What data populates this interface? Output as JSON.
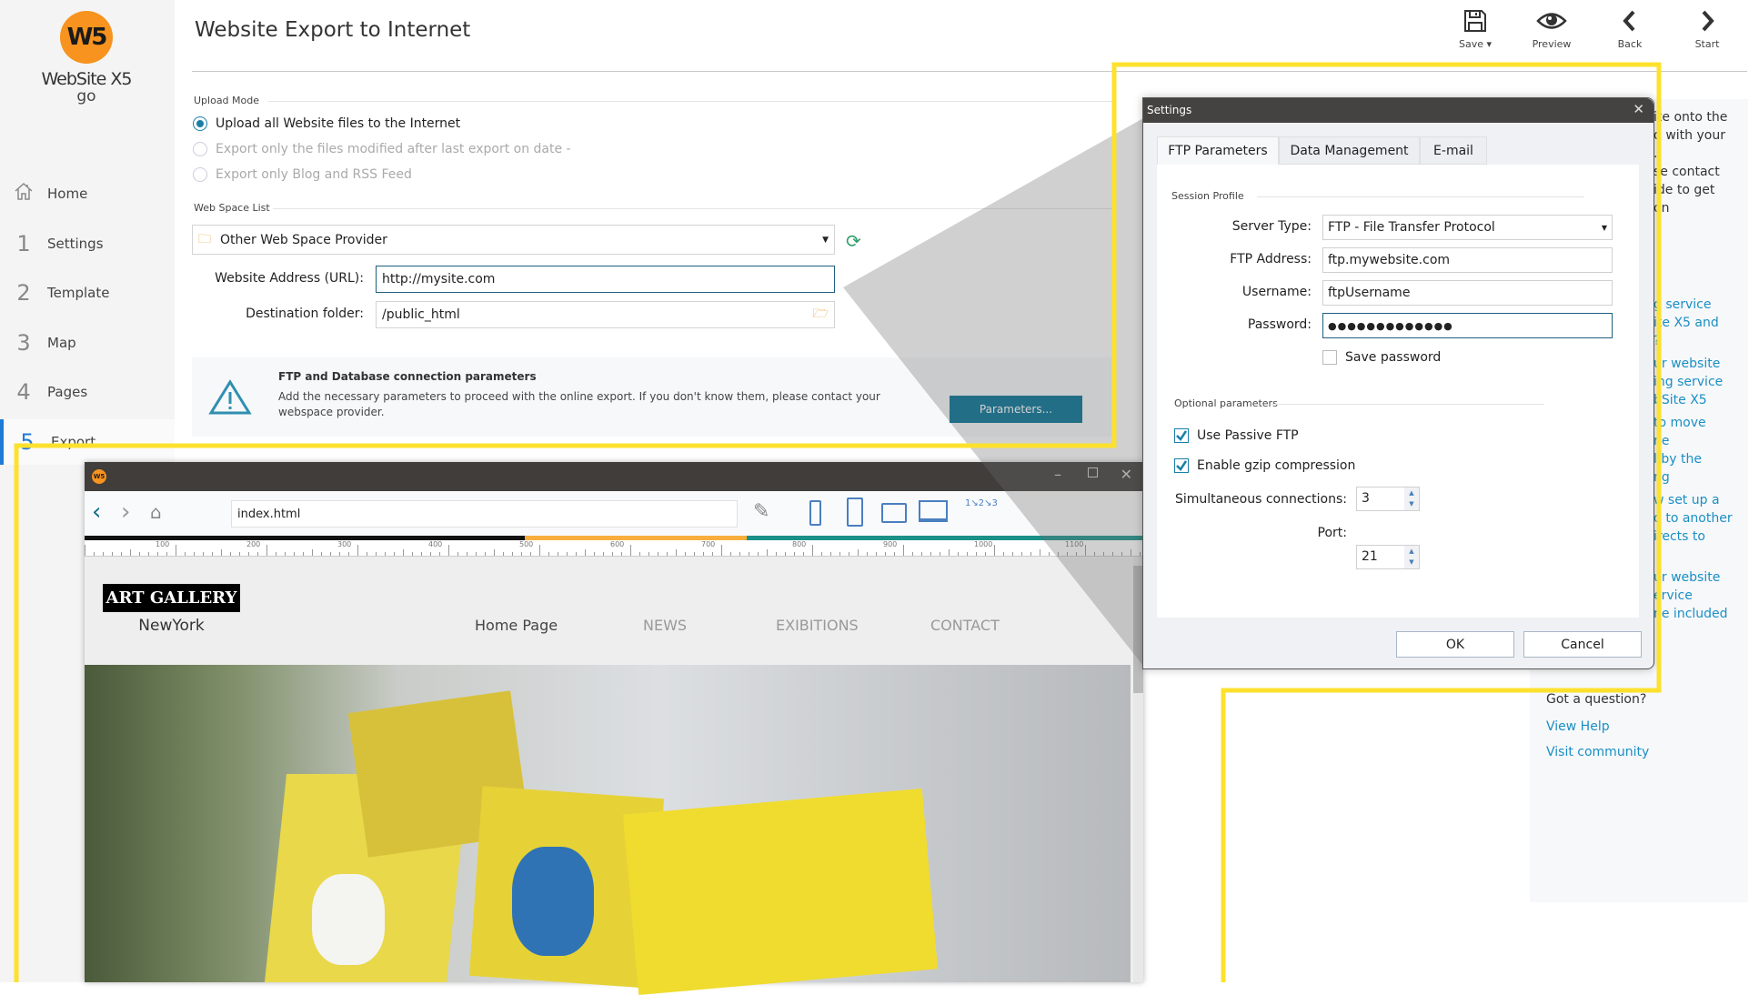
{
  "app": {
    "logo_text": "W5",
    "brand": "WebSite X5",
    "brand_sub": "go"
  },
  "sidebar": {
    "items": [
      {
        "num": "",
        "label": "Home"
      },
      {
        "num": "1",
        "label": "Settings"
      },
      {
        "num": "2",
        "label": "Template"
      },
      {
        "num": "3",
        "label": "Map"
      },
      {
        "num": "4",
        "label": "Pages"
      },
      {
        "num": "5",
        "label": "Export",
        "active": true
      }
    ]
  },
  "header": {
    "title": "Website Export to Internet"
  },
  "toolbar": {
    "save": "Save",
    "preview": "Preview",
    "back": "Back",
    "start": "Start"
  },
  "main": {
    "upload_mode_label": "Upload Mode",
    "upload_options": [
      {
        "label": "Upload all Website files to the Internet",
        "selected": true,
        "enabled": true
      },
      {
        "label": "Export only the files modified after last export on date -",
        "selected": false,
        "enabled": false
      },
      {
        "label": "Export only Blog and RSS Feed",
        "selected": false,
        "enabled": false
      }
    ],
    "web_space_label": "Web Space List",
    "web_space_value": "Other Web Space Provider",
    "url_label": "Website Address (URL):",
    "url_value": "http://mysite.com",
    "dest_label": "Destination folder:",
    "dest_value": "/public_html",
    "info_title": "FTP and Database connection parameters",
    "info_text": "Add the necessary parameters to proceed with the online export. If you don't know them, please contact your webspace provider.",
    "parameters_button": "Parameters..."
  },
  "help": {
    "fragments_dark": [
      "ite onto the",
      "d with your",
      ".",
      "se contact",
      "ide to get",
      "on"
    ],
    "fragments_link": [
      "g service",
      "ite X5 and",
      "?",
      "ur website",
      "ing service",
      "bSite X5",
      "to move",
      "ne",
      "l by the",
      "ng",
      "w set up a",
      "d to another",
      "irects to",
      "ur website",
      "ervice",
      "ne included"
    ],
    "question": "Got a question?",
    "view_help": "View Help",
    "visit_community": "Visit community"
  },
  "preview_window": {
    "address": "index.html",
    "ruler_ticks": [
      "100",
      "200",
      "300",
      "400",
      "500",
      "600",
      "700",
      "800",
      "900",
      "1000",
      "1100"
    ],
    "site_logo": "ART GALLERY",
    "site_logo_sub": "NewYork",
    "site_nav": [
      "Home Page",
      "NEWS",
      "EXIBITIONS",
      "CONTACT"
    ]
  },
  "settings_dialog": {
    "title": "Settings",
    "tabs": [
      "FTP Parameters",
      "Data Management",
      "E-mail"
    ],
    "session_profile": "Session Profile",
    "server_type_label": "Server Type:",
    "server_type_value": "FTP - File Transfer Protocol",
    "ftp_address_label": "FTP Address:",
    "ftp_address_value": "ftp.mywebsite.com",
    "username_label": "Username:",
    "username_value": "ftpUsername",
    "password_label": "Password:",
    "password_value": "●●●●●●●●●●●●●",
    "save_password": "Save password",
    "save_password_checked": false,
    "optional_params": "Optional parameters",
    "passive_ftp": "Use Passive FTP",
    "passive_ftp_checked": true,
    "gzip": "Enable gzip compression",
    "gzip_checked": true,
    "connections_label": "Simultaneous connections:",
    "connections_value": "3",
    "port_label": "Port:",
    "port_value": "21",
    "ok": "OK",
    "cancel": "Cancel"
  },
  "colors": {
    "accent": "#006f94",
    "highlight": "#fde12d",
    "link": "#1a8fc4",
    "logo": "#f7931e"
  }
}
